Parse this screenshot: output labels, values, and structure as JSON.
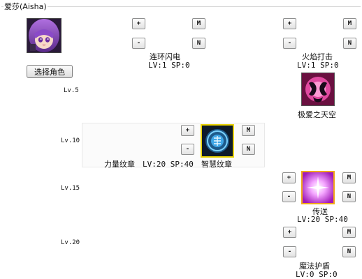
{
  "window": {
    "group_title": "爱莎(Aisha)"
  },
  "character": {
    "select_button": "选择角色"
  },
  "levels": [
    "Lv.5",
    "Lv.10",
    "Lv.15",
    "Lv.20"
  ],
  "buttons": {
    "plus": "+",
    "minus": "-",
    "max": "M",
    "none": "N"
  },
  "skills": {
    "chain_lightning": {
      "name": "连环闪电",
      "stats": "LV:1  SP:0"
    },
    "fire_strike": {
      "name": "火焰打击",
      "stats": "LV:1  SP:0"
    },
    "ultimate": {
      "name": "极爱之天空"
    },
    "power_emblem": {
      "name": "力量纹章",
      "stats": "LV:20  SP:40"
    },
    "wisdom_emblem": {
      "name": "智慧纹章"
    },
    "teleport": {
      "name": "传送",
      "stats": "LV:20 SP:40"
    },
    "magic_shield": {
      "name": "魔法护盾",
      "stats": "LV:0  SP:0"
    }
  },
  "colors": {
    "selected_border": "#f0a81a",
    "wisdom_border": "#e8d200",
    "window_bg": "#ffffff"
  }
}
